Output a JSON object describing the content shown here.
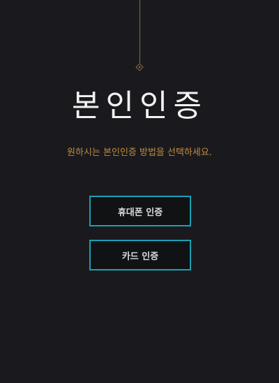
{
  "header": {
    "title": "본인인증",
    "subtitle": "원하시는 본인인증 방법을 선택하세요."
  },
  "options": {
    "phone_label": "휴대폰 인증",
    "card_label": "카드 인증"
  },
  "colors": {
    "background": "#1a1a1e",
    "accent_gold": "#c28a3c",
    "button_border": "#1aa0b4",
    "title_text": "#f2f2f2"
  },
  "icons": {
    "top_ornament": "diamond-ornament-icon"
  }
}
